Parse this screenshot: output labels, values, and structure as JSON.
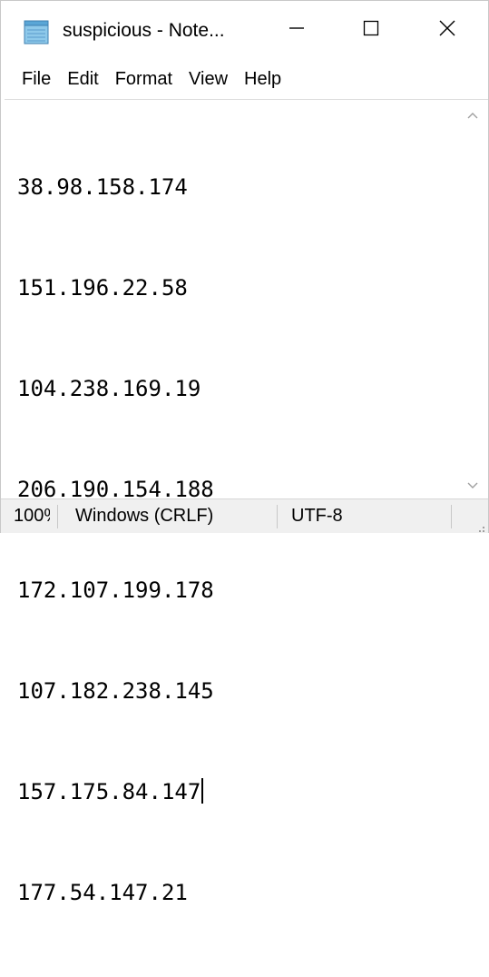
{
  "window": {
    "title": "suspicious - Note...",
    "icon": "notepad-icon"
  },
  "caption_buttons": {
    "minimize_icon": "minimize-icon",
    "maximize_icon": "maximize-icon",
    "close_icon": "close-icon"
  },
  "menu": {
    "items": [
      {
        "label": "File"
      },
      {
        "label": "Edit"
      },
      {
        "label": "Format"
      },
      {
        "label": "View"
      },
      {
        "label": "Help"
      }
    ]
  },
  "editor": {
    "lines": [
      "38.98.158.174",
      "151.196.22.58",
      "104.238.169.19",
      "206.190.154.188",
      "172.107.199.178",
      "107.182.238.145",
      "157.175.84.147",
      "177.54.147.21"
    ],
    "caret_line": 6
  },
  "statusbar": {
    "zoom": "100%",
    "line_ending": "Windows (CRLF)",
    "encoding": "UTF-8"
  },
  "colors": {
    "background": "#ffffff",
    "statusbar": "#f0f0f0",
    "text": "#000000"
  }
}
